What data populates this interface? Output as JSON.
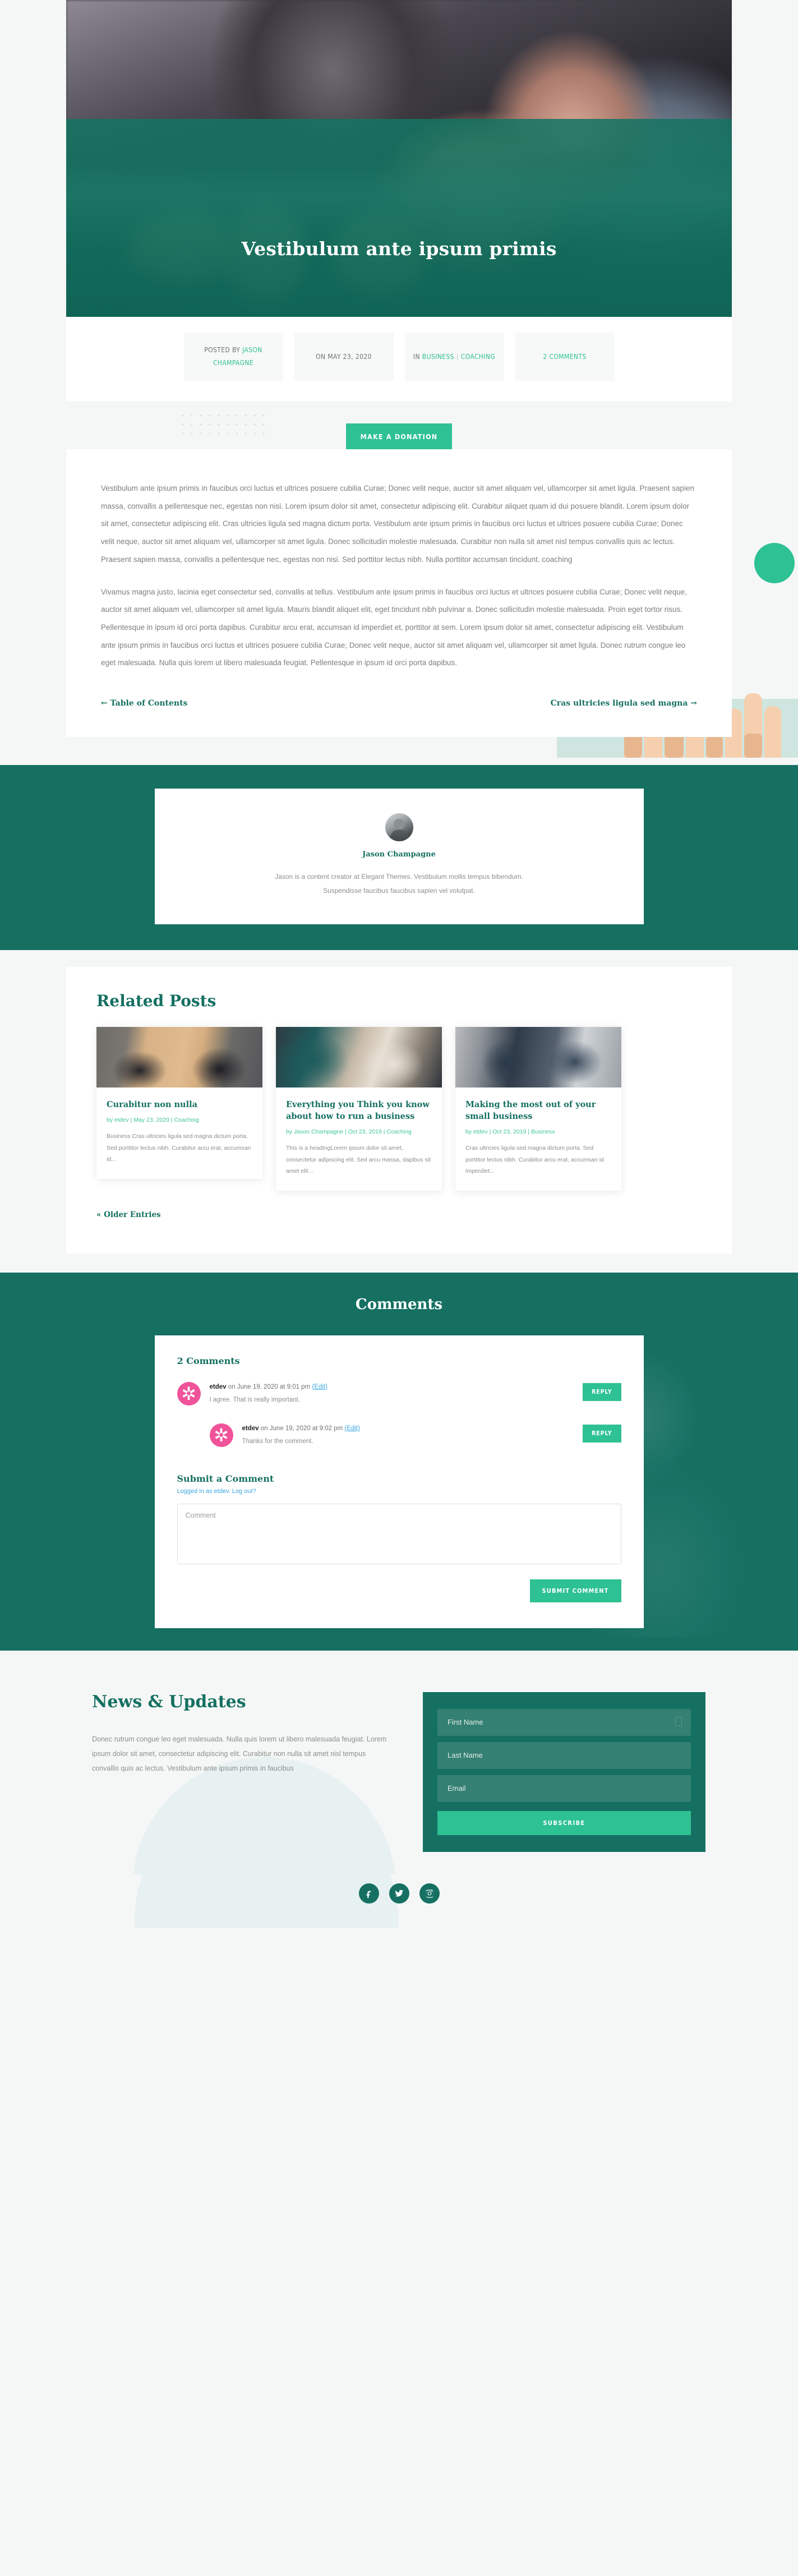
{
  "hero": {
    "title": "Vestibulum ante ipsum primis"
  },
  "meta": {
    "author_prefix": "POSTED BY",
    "author": "JASON CHAMPAGNE",
    "date": "ON MAY 23, 2020",
    "category_prefix": "IN",
    "category_1": "BUSINESS",
    "category_sep": "|",
    "category_2": "COACHING",
    "comments": "2 COMMENTS"
  },
  "donation": {
    "label": "MAKE A DONATION"
  },
  "article": {
    "paragraph_1": "Vestibulum ante ipsum primis in faucibus orci luctus et ultrices posuere cubilia Curae; Donec velit neque, auctor sit amet aliquam vel, ullamcorper sit amet ligula. Praesent sapien massa, convallis a pellentesque nec, egestas non nisi. Lorem ipsum dolor sit amet, consectetur adipiscing elit. Curabitur aliquet quam id dui posuere blandit. Lorem ipsum dolor sit amet, consectetur adipiscing elit. Cras ultricies ligula sed magna dictum porta. Vestibulum ante ipsum primis in faucibus orci luctus et ultrices posuere cubilia Curae; Donec velit neque, auctor sit amet aliquam vel, ullamcorper sit amet ligula. Donec sollicitudin molestie malesuada. Curabitur non nulla sit amet nisl tempus convallis quis ac lectus. Praesent sapien massa, convallis a pellentesque nec, egestas non nisi. Sed porttitor lectus nibh. Nulla porttitor accumsan tincidunt. coaching",
    "paragraph_2": "Vivamus magna justo, lacinia eget consectetur sed, convallis at tellus. Vestibulum ante ipsum primis in faucibus orci luctus et ultrices posuere cubilia Curae; Donec velit neque, auctor sit amet aliquam vel, ullamcorper sit amet ligula. Mauris blandit aliquet elit, eget tincidunt nibh pulvinar a. Donec sollicitudin molestie malesuada. Proin eget tortor risus. Pellentesque in ipsum id orci porta dapibus. Curabitur arcu erat, accumsan id imperdiet et, porttitor at sem. Lorem ipsum dolor sit amet, consectetur adipiscing elit. Vestibulum ante ipsum primis in faucibus orci luctus et ultrices posuere cubilia Curae; Donec velit neque, auctor sit amet aliquam vel, ullamcorper sit amet ligula. Donec rutrum congue leo eget malesuada. Nulla quis lorem ut libero malesuada feugiat. Pellentesque in ipsum id orci porta dapibus.",
    "prev_link": "← Table of Contents",
    "next_link": "Cras ultricies ligula sed magna →"
  },
  "author": {
    "name": "Jason Champagne",
    "bio_line_1": "Jason is a content creator at Elegant Themes. Vestibulum mollis tempus bibendum.",
    "bio_line_2": "Suspendisse faucibus faucibus sapien vel volutpat."
  },
  "related": {
    "heading": "Related Posts",
    "older_label": "« Older Entries",
    "cards": [
      {
        "title": "Curabitur non nulla",
        "meta": "by etdev | May 23, 2020 | Coaching",
        "excerpt": "Business Cras ultricies ligula sed magna dictum porta. Sed porttitor lectus nibh. Curabitur arcu erat, accumsan id..."
      },
      {
        "title": "Everything you Think you know about how to run a business",
        "meta": "by Jason Champagne | Oct 23, 2019 | Coaching",
        "excerpt": "This is a headingLorem ipsum dolor sit amet, consectetur adipiscing elit. Sed arcu massa, dapibus sit amet elit..."
      },
      {
        "title": "Making the most out of your small business",
        "meta": "by etdev | Oct 23, 2019 | Business",
        "excerpt": "Cras ultricies ligula sed magna dictum porta. Sed porttitor lectus nibh. Curabitur arcu erat, accumsan id imperdiet..."
      }
    ]
  },
  "comments": {
    "section_title": "Comments",
    "count_label": "2 Comments",
    "reply_label": "REPLY",
    "items": [
      {
        "author": "etdev",
        "meta": " on June 19, 2020 at 9:01 pm ",
        "edit": "(Edit)",
        "text": "I agree. That is really important."
      },
      {
        "author": "etdev",
        "meta": " on June 19, 2020 at 9:02 pm ",
        "edit": "(Edit)",
        "text": "Thanks for the comment."
      }
    ],
    "form": {
      "heading": "Submit a Comment",
      "logged_in": "Logged in as etdev. Log out?",
      "comment_placeholder": "Comment",
      "submit_label": "SUBMIT COMMENT"
    }
  },
  "newsletter": {
    "heading": "News & Updates",
    "body": "Donec rutrum congue leo eget malesuada. Nulla quis lorem ut libero malesuada feugiat. Lorem ipsum dolor sit amet, consectetur adipiscing elit. Curabitur non nulla sit amet nisl tempus convallis quis ac lectus.  Vestibulum ante ipsum primis in faucibus",
    "first_name_placeholder": "First Name",
    "last_name_placeholder": "Last Name",
    "email_placeholder": "Email",
    "subscribe_label": "SUBSCRIBE"
  },
  "social": {
    "facebook": "facebook-icon",
    "twitter": "twitter-icon",
    "instagram": "instagram-icon"
  },
  "colors": {
    "brand_dark_green": "#157062",
    "accent_green": "#2ec193",
    "link_green": "#3fc59a",
    "link_blue": "#3aa6e0",
    "avatar_pink": "#f0539a",
    "page_bg": "#f5f7f6"
  }
}
